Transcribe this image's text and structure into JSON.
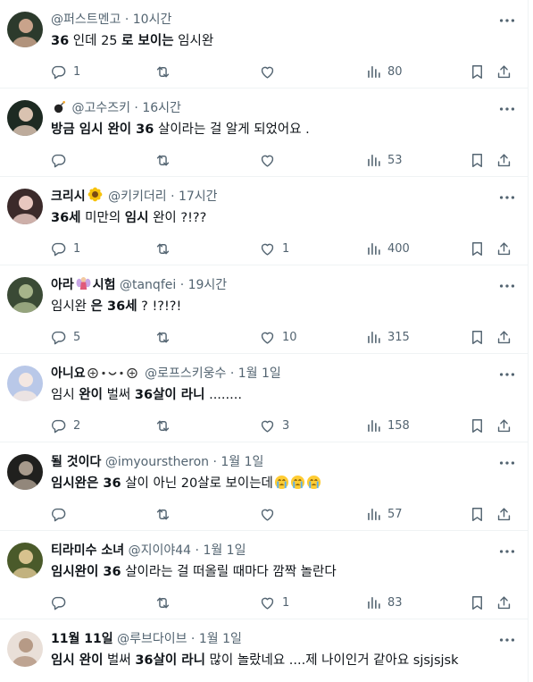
{
  "posts": [
    {
      "display_name": "",
      "prefix_icon": "",
      "handle": "@퍼스트멘고",
      "time": "10시간",
      "body": [
        {
          "t": "36",
          "b": true
        },
        {
          "t": " 인데 25 ",
          "b": false
        },
        {
          "t": "로 보이는",
          "b": true
        },
        {
          "t": " 임시완",
          "b": false
        }
      ],
      "reply_count": "1",
      "repost_count": "",
      "like_count": "",
      "view_count": "80",
      "avatar_colors": [
        "#2c3a2c",
        "#c9a38b"
      ]
    },
    {
      "display_name": "",
      "prefix_icon": "bomb-icon",
      "handle": "@고수즈키",
      "time": "16시간",
      "body": [
        {
          "t": "방금 임시 완이 36",
          "b": true
        },
        {
          "t": " 살이라는 걸 알게 되었어요 .",
          "b": false
        }
      ],
      "reply_count": "",
      "repost_count": "",
      "like_count": "",
      "view_count": "53",
      "avatar_colors": [
        "#1d2a22",
        "#d9c2b0"
      ]
    },
    {
      "display_name": "크리시",
      "name_emoji": "sunflower-icon",
      "handle": "@키키더리",
      "time": "17시간",
      "body": [
        {
          "t": "36세",
          "b": true
        },
        {
          "t": " 미만의 ",
          "b": false
        },
        {
          "t": "임시",
          "b": true
        },
        {
          "t": " 완이 ?!??",
          "b": false
        }
      ],
      "reply_count": "1",
      "repost_count": "",
      "like_count": "1",
      "view_count": "400",
      "avatar_colors": [
        "#3b2a2a",
        "#e8c7bf"
      ]
    },
    {
      "display_name": "아라",
      "name_emoji": "fairy-icon",
      "name_suffix": "시험",
      "handle": "@tanqfei",
      "time": "19시간",
      "body": [
        {
          "t": "임시완 ",
          "b": false
        },
        {
          "t": "은 36세",
          "b": true
        },
        {
          "t": " ? !?!?!",
          "b": false
        }
      ],
      "reply_count": "5",
      "repost_count": "",
      "like_count": "10",
      "view_count": "315",
      "avatar_colors": [
        "#3a4a35",
        "#a6b48a"
      ]
    },
    {
      "display_name": "아니요",
      "name_emoji": "kaomoji-icon",
      "handle": "@로프스키웅수",
      "time": "1월 1일",
      "body": [
        {
          "t": "임시 ",
          "b": false
        },
        {
          "t": "완이",
          "b": true
        },
        {
          "t": " 벌써 ",
          "b": false
        },
        {
          "t": "36살이 라니",
          "b": true
        },
        {
          "t": " ........",
          "b": false
        }
      ],
      "reply_count": "2",
      "repost_count": "",
      "like_count": "3",
      "view_count": "158",
      "avatar_colors": [
        "#b9c8e8",
        "#f3e7e2"
      ]
    },
    {
      "display_name": "될 것이다",
      "handle": "@imyourstheron",
      "time": "1월 1일",
      "body": [
        {
          "t": "임시완은 36",
          "b": true
        },
        {
          "t": " 살이 아닌 20살로 보이는데",
          "b": false
        }
      ],
      "body_emojis": 3,
      "reply_count": "",
      "repost_count": "",
      "like_count": "",
      "view_count": "57",
      "avatar_colors": [
        "#20201e",
        "#a79a8c"
      ]
    },
    {
      "display_name": "티라미수 소녀",
      "handle": "@지이야44",
      "time": "1월 1일",
      "body": [
        {
          "t": "임시완이 36",
          "b": true
        },
        {
          "t": " 살이라는 걸 떠올릴 때마다 깜짝 놀란다",
          "b": false
        }
      ],
      "reply_count": "",
      "repost_count": "",
      "like_count": "1",
      "view_count": "83",
      "avatar_colors": [
        "#4a5a2a",
        "#d7c28e"
      ]
    },
    {
      "display_name": "11월 11일",
      "handle": "@루브다이브",
      "time": "1월 1일",
      "body": [
        {
          "t": "임시 완이",
          "b": true
        },
        {
          "t": " 벌써 ",
          "b": false
        },
        {
          "t": "36살이 라니",
          "b": true
        },
        {
          "t": " 많이 놀랐네요 ....제 나이인거 같아요 sjsjsjsk",
          "b": false
        }
      ],
      "reply_count": "",
      "repost_count": "",
      "like_count": "",
      "view_count": "",
      "avatar_colors": [
        "#e9dfd8",
        "#b69a86"
      ]
    }
  ],
  "icons": {
    "reply": "reply-icon",
    "repost": "repost-icon",
    "like": "like-icon",
    "views": "views-icon",
    "bookmark": "bookmark-icon",
    "share": "share-icon",
    "menu": "more-icon"
  },
  "colors": {
    "text": "#0f1419",
    "muted": "#536471",
    "divider": "#eff3f4"
  }
}
